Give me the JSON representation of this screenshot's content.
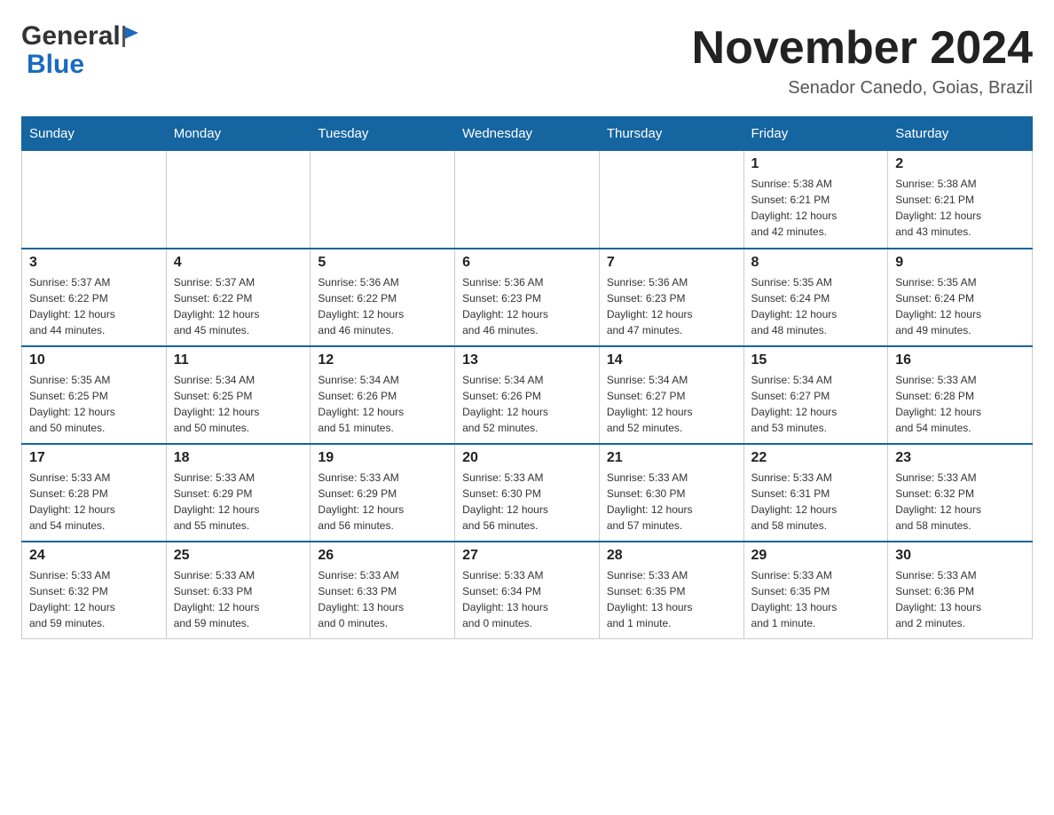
{
  "header": {
    "logo_general": "General",
    "logo_blue": "Blue",
    "month_title": "November 2024",
    "subtitle": "Senador Canedo, Goias, Brazil"
  },
  "weekdays": [
    "Sunday",
    "Monday",
    "Tuesday",
    "Wednesday",
    "Thursday",
    "Friday",
    "Saturday"
  ],
  "weeks": [
    [
      {
        "day": "",
        "info": ""
      },
      {
        "day": "",
        "info": ""
      },
      {
        "day": "",
        "info": ""
      },
      {
        "day": "",
        "info": ""
      },
      {
        "day": "",
        "info": ""
      },
      {
        "day": "1",
        "info": "Sunrise: 5:38 AM\nSunset: 6:21 PM\nDaylight: 12 hours\nand 42 minutes."
      },
      {
        "day": "2",
        "info": "Sunrise: 5:38 AM\nSunset: 6:21 PM\nDaylight: 12 hours\nand 43 minutes."
      }
    ],
    [
      {
        "day": "3",
        "info": "Sunrise: 5:37 AM\nSunset: 6:22 PM\nDaylight: 12 hours\nand 44 minutes."
      },
      {
        "day": "4",
        "info": "Sunrise: 5:37 AM\nSunset: 6:22 PM\nDaylight: 12 hours\nand 45 minutes."
      },
      {
        "day": "5",
        "info": "Sunrise: 5:36 AM\nSunset: 6:22 PM\nDaylight: 12 hours\nand 46 minutes."
      },
      {
        "day": "6",
        "info": "Sunrise: 5:36 AM\nSunset: 6:23 PM\nDaylight: 12 hours\nand 46 minutes."
      },
      {
        "day": "7",
        "info": "Sunrise: 5:36 AM\nSunset: 6:23 PM\nDaylight: 12 hours\nand 47 minutes."
      },
      {
        "day": "8",
        "info": "Sunrise: 5:35 AM\nSunset: 6:24 PM\nDaylight: 12 hours\nand 48 minutes."
      },
      {
        "day": "9",
        "info": "Sunrise: 5:35 AM\nSunset: 6:24 PM\nDaylight: 12 hours\nand 49 minutes."
      }
    ],
    [
      {
        "day": "10",
        "info": "Sunrise: 5:35 AM\nSunset: 6:25 PM\nDaylight: 12 hours\nand 50 minutes."
      },
      {
        "day": "11",
        "info": "Sunrise: 5:34 AM\nSunset: 6:25 PM\nDaylight: 12 hours\nand 50 minutes."
      },
      {
        "day": "12",
        "info": "Sunrise: 5:34 AM\nSunset: 6:26 PM\nDaylight: 12 hours\nand 51 minutes."
      },
      {
        "day": "13",
        "info": "Sunrise: 5:34 AM\nSunset: 6:26 PM\nDaylight: 12 hours\nand 52 minutes."
      },
      {
        "day": "14",
        "info": "Sunrise: 5:34 AM\nSunset: 6:27 PM\nDaylight: 12 hours\nand 52 minutes."
      },
      {
        "day": "15",
        "info": "Sunrise: 5:34 AM\nSunset: 6:27 PM\nDaylight: 12 hours\nand 53 minutes."
      },
      {
        "day": "16",
        "info": "Sunrise: 5:33 AM\nSunset: 6:28 PM\nDaylight: 12 hours\nand 54 minutes."
      }
    ],
    [
      {
        "day": "17",
        "info": "Sunrise: 5:33 AM\nSunset: 6:28 PM\nDaylight: 12 hours\nand 54 minutes."
      },
      {
        "day": "18",
        "info": "Sunrise: 5:33 AM\nSunset: 6:29 PM\nDaylight: 12 hours\nand 55 minutes."
      },
      {
        "day": "19",
        "info": "Sunrise: 5:33 AM\nSunset: 6:29 PM\nDaylight: 12 hours\nand 56 minutes."
      },
      {
        "day": "20",
        "info": "Sunrise: 5:33 AM\nSunset: 6:30 PM\nDaylight: 12 hours\nand 56 minutes."
      },
      {
        "day": "21",
        "info": "Sunrise: 5:33 AM\nSunset: 6:30 PM\nDaylight: 12 hours\nand 57 minutes."
      },
      {
        "day": "22",
        "info": "Sunrise: 5:33 AM\nSunset: 6:31 PM\nDaylight: 12 hours\nand 58 minutes."
      },
      {
        "day": "23",
        "info": "Sunrise: 5:33 AM\nSunset: 6:32 PM\nDaylight: 12 hours\nand 58 minutes."
      }
    ],
    [
      {
        "day": "24",
        "info": "Sunrise: 5:33 AM\nSunset: 6:32 PM\nDaylight: 12 hours\nand 59 minutes."
      },
      {
        "day": "25",
        "info": "Sunrise: 5:33 AM\nSunset: 6:33 PM\nDaylight: 12 hours\nand 59 minutes."
      },
      {
        "day": "26",
        "info": "Sunrise: 5:33 AM\nSunset: 6:33 PM\nDaylight: 13 hours\nand 0 minutes."
      },
      {
        "day": "27",
        "info": "Sunrise: 5:33 AM\nSunset: 6:34 PM\nDaylight: 13 hours\nand 0 minutes."
      },
      {
        "day": "28",
        "info": "Sunrise: 5:33 AM\nSunset: 6:35 PM\nDaylight: 13 hours\nand 1 minute."
      },
      {
        "day": "29",
        "info": "Sunrise: 5:33 AM\nSunset: 6:35 PM\nDaylight: 13 hours\nand 1 minute."
      },
      {
        "day": "30",
        "info": "Sunrise: 5:33 AM\nSunset: 6:36 PM\nDaylight: 13 hours\nand 2 minutes."
      }
    ]
  ]
}
